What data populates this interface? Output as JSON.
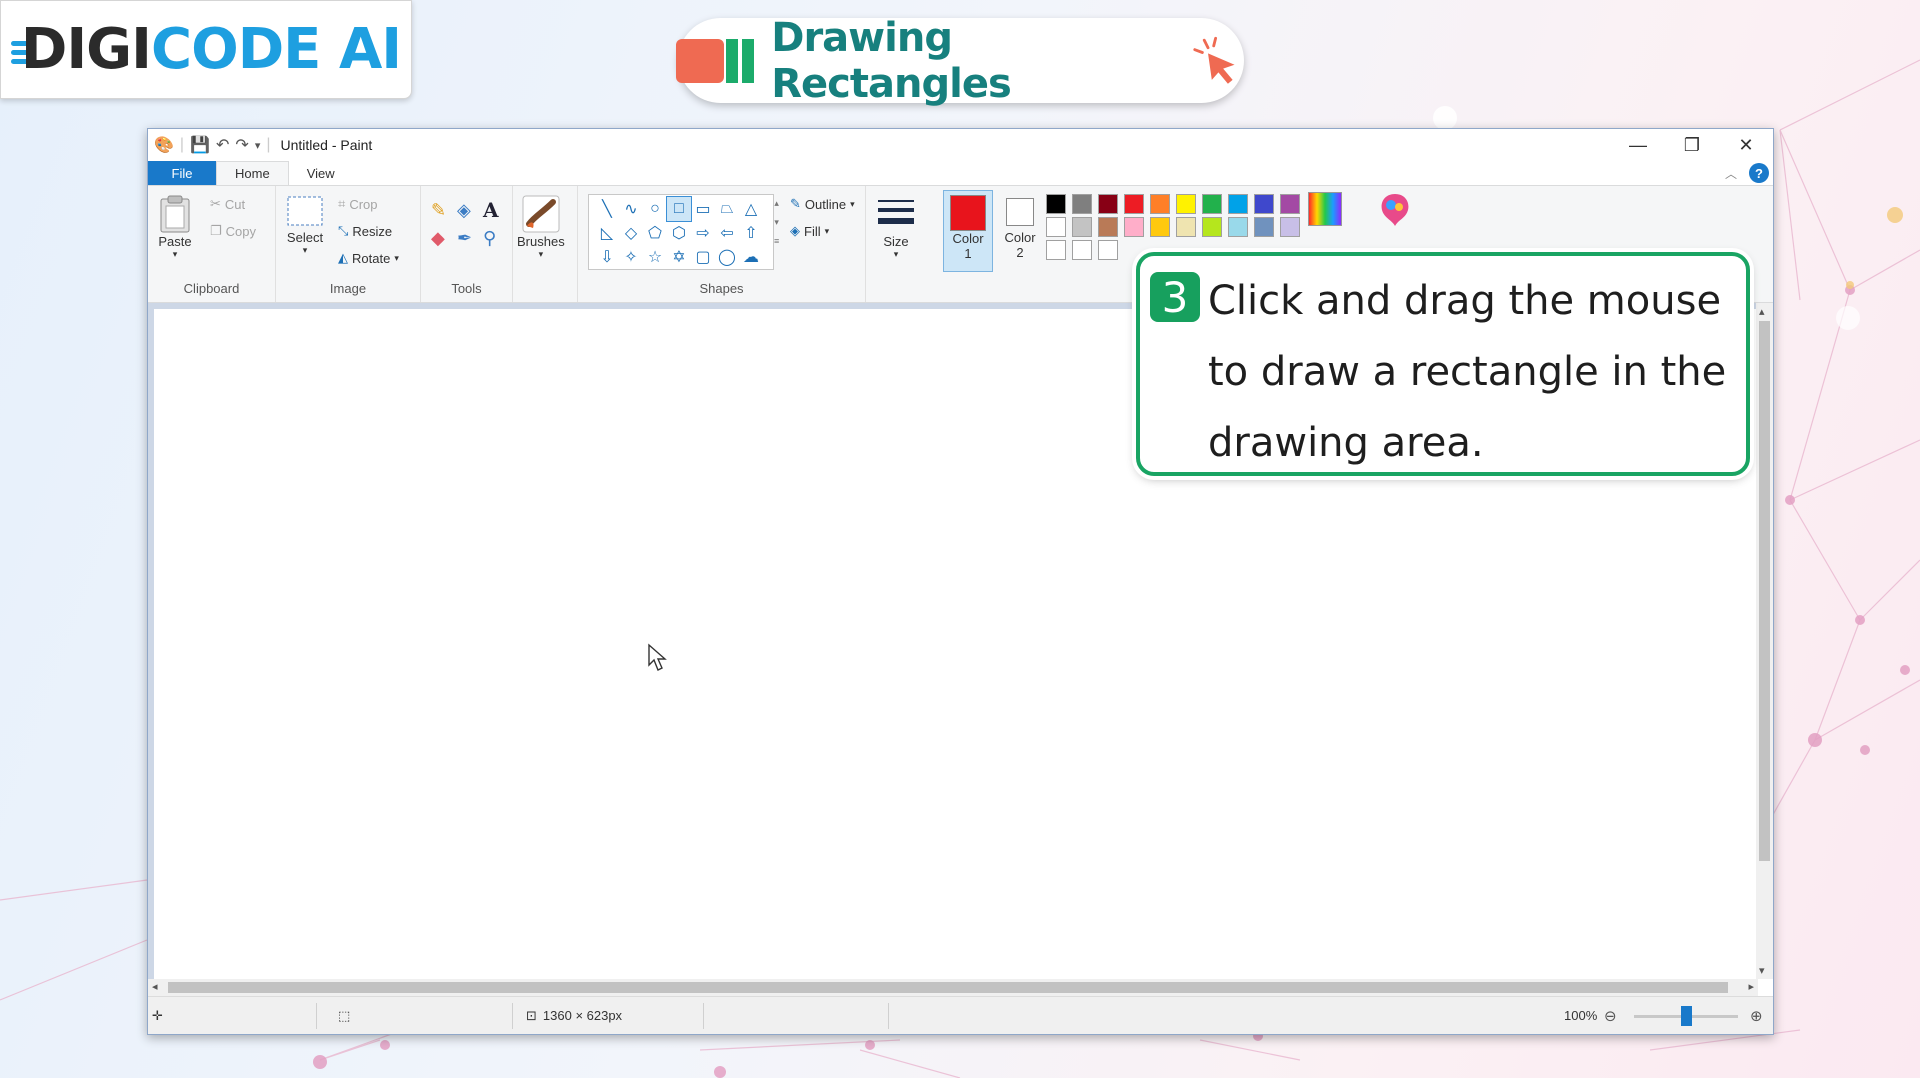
{
  "brand": {
    "logo_part1": "DIGI",
    "logo_part2": "CODE",
    "logo_part3": "AI"
  },
  "lesson": {
    "title": "Drawing Rectangles"
  },
  "window": {
    "title": "Untitled - Paint",
    "controls": {
      "minimize": "—",
      "restore": "❐",
      "close": "✕"
    }
  },
  "tabs": {
    "file": "File",
    "home": "Home",
    "view": "View"
  },
  "ribbon": {
    "clipboard": {
      "label": "Clipboard",
      "paste": "Paste",
      "cut": "Cut",
      "copy": "Copy"
    },
    "image": {
      "label": "Image",
      "select": "Select",
      "crop": "Crop",
      "resize": "Resize",
      "rotate": "Rotate"
    },
    "tools": {
      "label": "Tools"
    },
    "brushes": {
      "label": "Brushes"
    },
    "shapes": {
      "label": "Shapes",
      "outline": "Outline",
      "fill": "Fill"
    },
    "size": {
      "label": "Size"
    },
    "color1": {
      "line1": "Color",
      "line2": "1",
      "value": "#e8141c"
    },
    "color2": {
      "line1": "Color",
      "line2": "2",
      "value": "#ffffff"
    },
    "palette": [
      [
        "#000000",
        "#7f7f7f",
        "#880015",
        "#ed1c24",
        "#ff7f27",
        "#fff200",
        "#22b14c",
        "#00a2e8",
        "#3f48cc",
        "#a349a4"
      ],
      [
        "#ffffff",
        "#c3c3c3",
        "#b97a57",
        "#ffaec9",
        "#ffc90e",
        "#efe4b0",
        "#b5e61d",
        "#99d9ea",
        "#7092be",
        "#c8bfe7"
      ]
    ]
  },
  "status": {
    "canvas_size": "1360 × 623px",
    "zoom": "100%"
  },
  "callout": {
    "step": "3",
    "line1": "Click and drag the mouse",
    "line2": "to draw a rectangle in the",
    "line3": "drawing area."
  }
}
